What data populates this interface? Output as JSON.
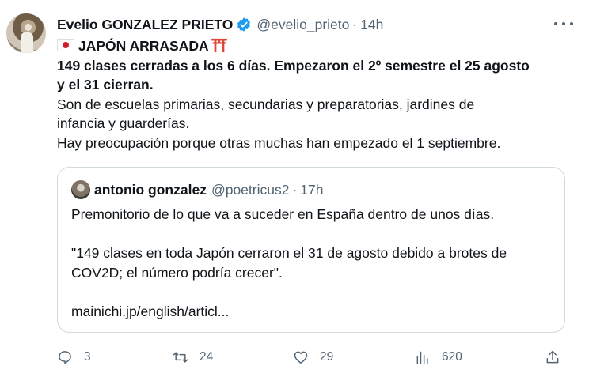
{
  "author": {
    "name": "Evelio GONZALEZ PRIETO",
    "handle": "@evelio_prieto",
    "separator": "·",
    "time": "14h"
  },
  "tweet": {
    "title": "JAPÓN ARRASADA",
    "lines_bold": [
      "149 clases cerradas a los 6 días. Empezaron el 2º semestre el 25 agosto",
      "y el 31 cierran."
    ],
    "lines_regular": [
      "Son de escuelas primarias, secundarias y preparatorias, jardines de",
      "infancia y guarderías.",
      "Hay preocupación porque otras muchas han empezado el 1 septiembre."
    ]
  },
  "quote": {
    "name": "antonio gonzalez",
    "handle": "@poetricus2",
    "separator": "·",
    "time": "17h",
    "line1": "Premonitorio de lo que va a suceder en España dentro de unos días.",
    "line2": "\"149 clases en toda Japón cerraron el 31 de agosto debido a brotes de",
    "line3": "COV2D; el número podría crecer\".",
    "link": "mainichi.jp/english/articl..."
  },
  "actions": {
    "replies": "3",
    "retweets": "24",
    "likes": "29",
    "views": "620"
  },
  "colors": {
    "text": "#0f1419",
    "secondary": "#536471",
    "verified": "#1d9bf0",
    "border": "#cfd9de",
    "flag_red": "#d11a2a",
    "torii_red": "#e0453a"
  },
  "icons": [
    "verified-badge-icon",
    "more-icon",
    "japan-flag-icon",
    "torii-icon",
    "reply-icon",
    "retweet-icon",
    "like-icon",
    "views-icon",
    "share-icon"
  ]
}
